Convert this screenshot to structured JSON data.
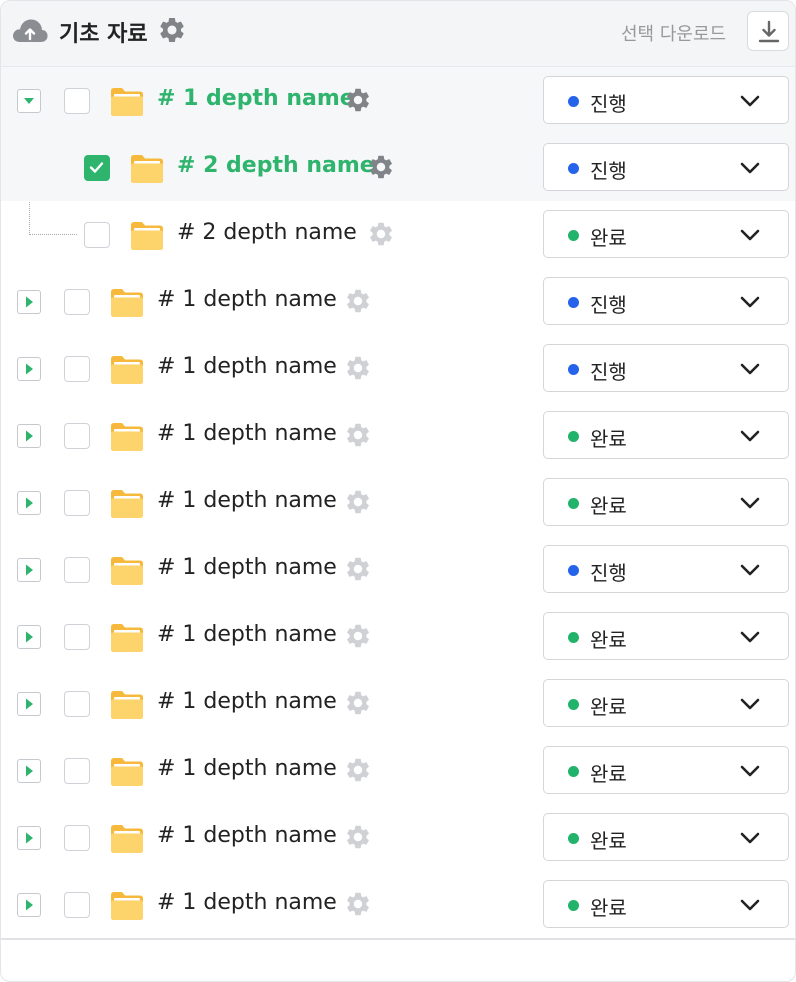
{
  "header": {
    "title": "기초 자료",
    "download_label": "선택 다운로드",
    "cloud_icon": "cloud-upload-icon",
    "settings_icon": "gear-icon",
    "download_icon": "download-icon"
  },
  "colors": {
    "accent_green": "#2fb46e",
    "status_progress": "#2563eb",
    "status_done": "#22b36b",
    "folder": "#fbc94b"
  },
  "rows": [
    {
      "level": 1,
      "name": "# 1 depth name",
      "expanded": true,
      "checked": false,
      "highlight": true,
      "status": "진행",
      "status_kind": "progress"
    },
    {
      "level": 2,
      "name": "# 2 depth name",
      "checked": true,
      "highlight": true,
      "status": "진행",
      "status_kind": "progress"
    },
    {
      "level": 2,
      "name": "# 2 depth name",
      "checked": false,
      "highlight": false,
      "status": "완료",
      "status_kind": "done"
    },
    {
      "level": 1,
      "name": "# 1 depth name",
      "expanded": false,
      "checked": false,
      "status": "진행",
      "status_kind": "progress"
    },
    {
      "level": 1,
      "name": "# 1 depth name",
      "expanded": false,
      "checked": false,
      "status": "진행",
      "status_kind": "progress"
    },
    {
      "level": 1,
      "name": "# 1 depth name",
      "expanded": false,
      "checked": false,
      "status": "완료",
      "status_kind": "done"
    },
    {
      "level": 1,
      "name": "# 1 depth name",
      "expanded": false,
      "checked": false,
      "status": "완료",
      "status_kind": "done"
    },
    {
      "level": 1,
      "name": "# 1 depth name",
      "expanded": false,
      "checked": false,
      "status": "진행",
      "status_kind": "progress"
    },
    {
      "level": 1,
      "name": "# 1 depth name",
      "expanded": false,
      "checked": false,
      "status": "완료",
      "status_kind": "done"
    },
    {
      "level": 1,
      "name": "# 1 depth name",
      "expanded": false,
      "checked": false,
      "status": "완료",
      "status_kind": "done"
    },
    {
      "level": 1,
      "name": "# 1 depth name",
      "expanded": false,
      "checked": false,
      "status": "완료",
      "status_kind": "done"
    },
    {
      "level": 1,
      "name": "# 1 depth name",
      "expanded": false,
      "checked": false,
      "status": "완료",
      "status_kind": "done"
    },
    {
      "level": 1,
      "name": "# 1 depth name",
      "expanded": false,
      "checked": false,
      "status": "완료",
      "status_kind": "done"
    }
  ]
}
